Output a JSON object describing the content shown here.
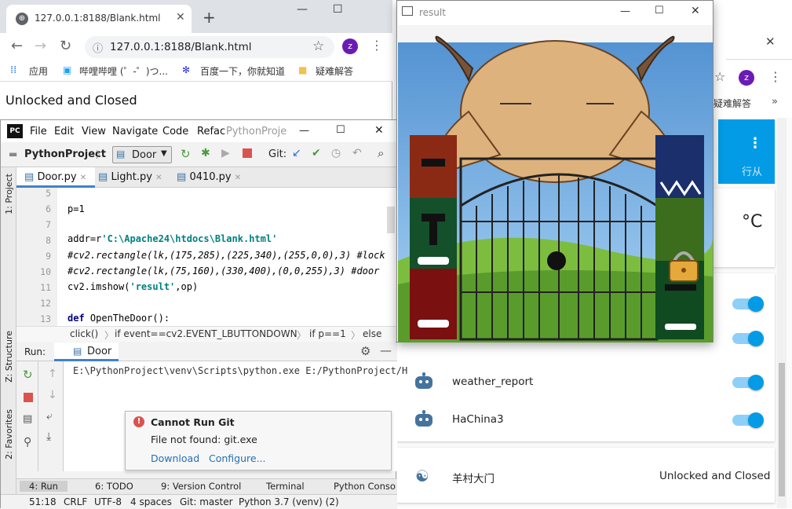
{
  "chrome": {
    "tab_title": "127.0.0.1:8188/Blank.html",
    "url": "127.0.0.1:8188/Blank.html",
    "avatar": "z",
    "bookmarks": [
      "应用",
      "哔哩哔哩 (゜-゜)つ...",
      "百度一下，你就知道",
      "疑难解答"
    ],
    "content": "Unlocked and Closed"
  },
  "pycharm": {
    "menu": [
      "File",
      "Edit",
      "View",
      "Navigate",
      "Code",
      "Refac",
      "PythonProje"
    ],
    "project": "PythonProject",
    "run_config": "Door",
    "git_label": "Git:",
    "tabs": [
      "Door.py",
      "Light.py",
      "0410.py"
    ],
    "side_labels": [
      "1: Project",
      "Z: Structure",
      "2: Favorites"
    ],
    "line_numbers": [
      "5",
      "6",
      "7",
      "8",
      "9",
      "10",
      "11",
      "12",
      "13"
    ],
    "code": {
      "l6": "p=1",
      "l8a": "addr=r",
      "l8b": "'C:\\Apache24\\htdocs\\Blank.html'",
      "l9": "#cv2.rectangle(lk,(175,285),(225,340),(255,0,0),3) #lock",
      "l10": "#cv2.rectangle(lk,(75,160),(330,400),(0,0,255),3) #door",
      "l11a": "cv2.imshow(",
      "l11b": "'result'",
      "l11c": ",op)",
      "l13a": "def",
      "l13b": " OpenTheDoor():"
    },
    "breadcrumbs": [
      "click()",
      "if event==cv2.EVENT_LBUTTONDOWN",
      "if p==1",
      "else"
    ],
    "run_label": "Run:",
    "run_tab": "Door",
    "console": "E:\\PythonProject\\venv\\Scripts\\python.exe E:/PythonProject/H",
    "notification": {
      "title": "Cannot Run Git",
      "body": "File not found: git.exe",
      "action1": "Download",
      "action2": "Configure..."
    },
    "bottom_tabs": [
      "4: Run",
      "6: TODO",
      "9: Version Control",
      "Terminal",
      "Python Console"
    ],
    "status": [
      "51:18",
      "CRLF",
      "UTF-8",
      "4 spaces",
      "Git: master",
      "Python 3.7 (venv) (2)"
    ]
  },
  "result_window": {
    "title": "result"
  },
  "ha": {
    "avatar": "z",
    "bookmark": "疑难解答",
    "header_partial": "行从",
    "temp_unit": "°C",
    "entities": [
      {
        "name": "weather_report",
        "on": true
      },
      {
        "name": "HaChina3",
        "on": true
      }
    ],
    "door_name": "羊村大门",
    "door_state": "Unlocked and Closed"
  }
}
